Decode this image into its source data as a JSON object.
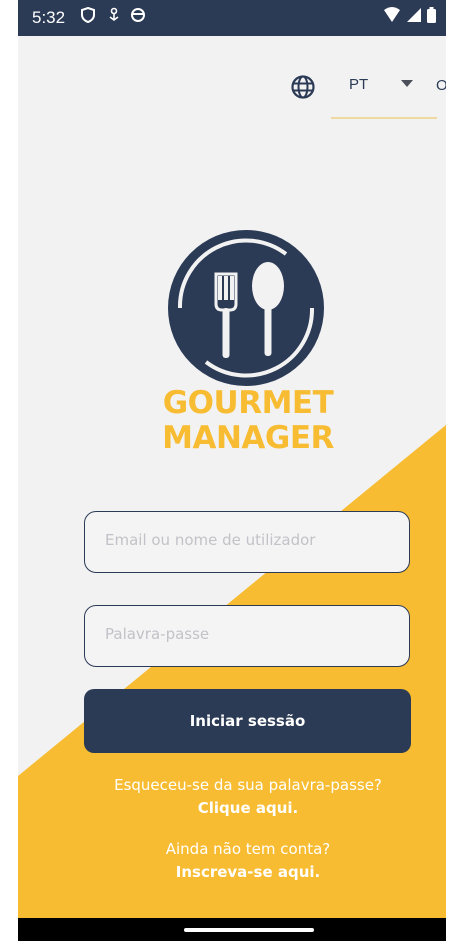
{
  "status_bar": {
    "time": "5:32",
    "icons_left": [
      "shield-icon",
      "usb-icon",
      "circle-icon"
    ],
    "icons_right": [
      "wifi-icon",
      "signal-icon",
      "battery-icon"
    ]
  },
  "language": {
    "globe_icon": "globe-icon",
    "selected": "PT",
    "ok_label": "OK"
  },
  "brand": {
    "line1": "GOURMET",
    "line2": "MANAGER",
    "logo_icon": "fork-spoon-logo",
    "colors": {
      "primary": "#2b3a55",
      "accent": "#f7bc31"
    }
  },
  "form": {
    "email_placeholder": "Email ou nome de utilizador",
    "email_value": "",
    "password_placeholder": "Palavra-passe",
    "password_value": "",
    "login_label": "Iniciar sessão"
  },
  "links": {
    "forgot_text": "Esqueceu-se da sua palavra-passe?",
    "forgot_link": "Clique aqui.",
    "signup_text": "Ainda não tem conta?",
    "signup_link": "Inscreva-se aqui."
  }
}
